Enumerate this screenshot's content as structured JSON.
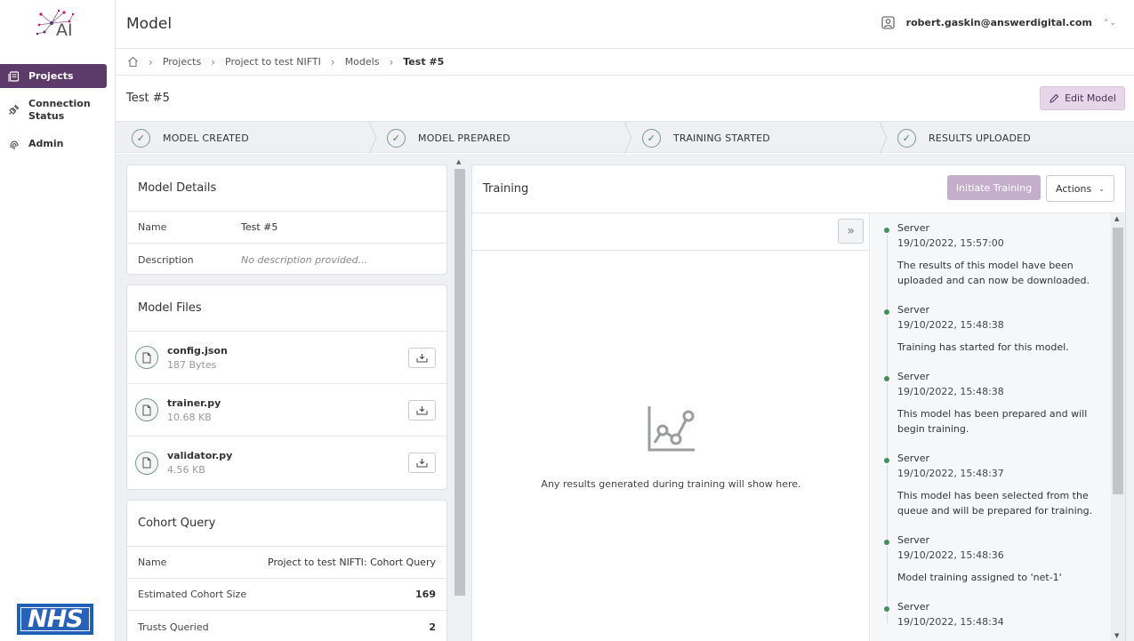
{
  "app": {
    "logo_text": "AI"
  },
  "sidebar": {
    "items": [
      {
        "label": "Projects",
        "icon": "projects-icon",
        "active": true
      },
      {
        "label": "Connection Status",
        "icon": "plug-icon",
        "active": false
      },
      {
        "label": "Admin",
        "icon": "fingerprint-icon",
        "active": false
      }
    ],
    "footer_logo": "NHS"
  },
  "header": {
    "title": "Model",
    "user_email": "robert.gaskin@answerdigital.com"
  },
  "breadcrumb": {
    "items": [
      "Projects",
      "Project to test NIFTI",
      "Models"
    ],
    "current": "Test #5"
  },
  "model": {
    "name_heading": "Test #5",
    "edit_label": "Edit Model"
  },
  "steps": [
    {
      "label": "MODEL CREATED",
      "done": true
    },
    {
      "label": "MODEL PREPARED",
      "done": true
    },
    {
      "label": "TRAINING STARTED",
      "done": true
    },
    {
      "label": "RESULTS UPLOADED",
      "done": true
    }
  ],
  "model_details": {
    "title": "Model Details",
    "rows": [
      {
        "key": "Name",
        "value": "Test #5"
      },
      {
        "key": "Description",
        "value": "No description provided..."
      }
    ]
  },
  "model_files": {
    "title": "Model Files",
    "files": [
      {
        "name": "config.json",
        "size": "187 Bytes"
      },
      {
        "name": "trainer.py",
        "size": "10.68 KB"
      },
      {
        "name": "validator.py",
        "size": "4.56 KB"
      }
    ]
  },
  "cohort_query": {
    "title": "Cohort Query",
    "rows": [
      {
        "key": "Name",
        "value": "Project to test NIFTI: Cohort Query"
      },
      {
        "key": "Estimated Cohort Size",
        "value": "169"
      },
      {
        "key": "Trusts Queried",
        "value": "2"
      }
    ]
  },
  "training": {
    "title": "Training",
    "initiate_label": "Initiate Training",
    "actions_label": "Actions",
    "empty_text": "Any results generated during training will show here.",
    "log": [
      {
        "who": "Server",
        "when": "19/10/2022, 15:57:00",
        "msg": "The results of this model have been uploaded and can now be downloaded."
      },
      {
        "who": "Server",
        "when": "19/10/2022, 15:48:38",
        "msg": "Training has started for this model."
      },
      {
        "who": "Server",
        "when": "19/10/2022, 15:48:38",
        "msg": "This model has been prepared and will begin training."
      },
      {
        "who": "Server",
        "when": "19/10/2022, 15:48:37",
        "msg": "This model has been selected from the queue and will be prepared for training."
      },
      {
        "who": "Server",
        "when": "19/10/2022, 15:48:36",
        "msg": "Model training assigned to 'net-1'"
      },
      {
        "who": "Server",
        "when": "19/10/2022, 15:48:34",
        "msg": ""
      }
    ]
  },
  "colors": {
    "brand_purple": "#5c3b6a",
    "accent_soft": "#e7d6ea",
    "success_green": "#3f8f5f",
    "nhs_blue": "#2761b8"
  }
}
